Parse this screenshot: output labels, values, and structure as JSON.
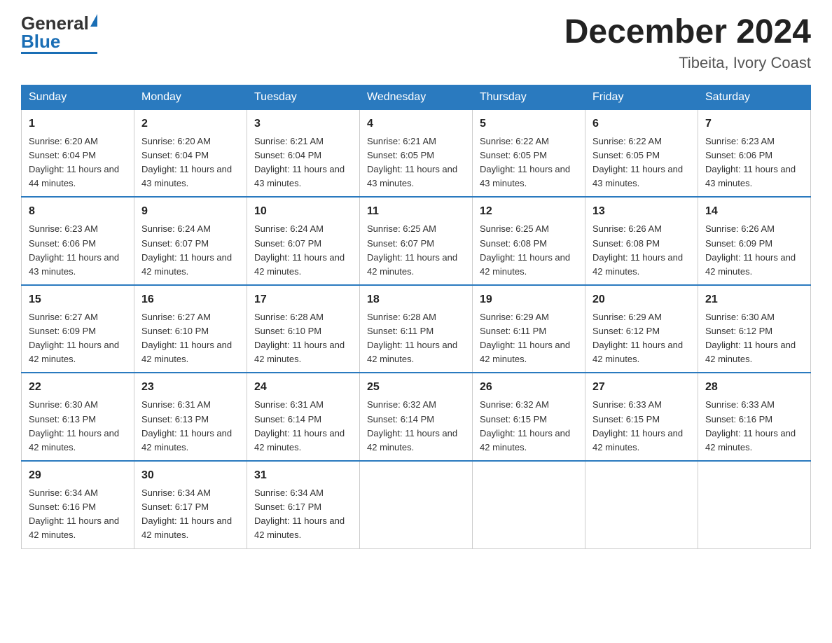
{
  "logo": {
    "general": "General",
    "blue": "Blue"
  },
  "title": "December 2024",
  "location": "Tibeita, Ivory Coast",
  "days_of_week": [
    "Sunday",
    "Monday",
    "Tuesday",
    "Wednesday",
    "Thursday",
    "Friday",
    "Saturday"
  ],
  "weeks": [
    [
      {
        "day": "1",
        "sunrise": "6:20 AM",
        "sunset": "6:04 PM",
        "daylight": "11 hours and 44 minutes."
      },
      {
        "day": "2",
        "sunrise": "6:20 AM",
        "sunset": "6:04 PM",
        "daylight": "11 hours and 43 minutes."
      },
      {
        "day": "3",
        "sunrise": "6:21 AM",
        "sunset": "6:04 PM",
        "daylight": "11 hours and 43 minutes."
      },
      {
        "day": "4",
        "sunrise": "6:21 AM",
        "sunset": "6:05 PM",
        "daylight": "11 hours and 43 minutes."
      },
      {
        "day": "5",
        "sunrise": "6:22 AM",
        "sunset": "6:05 PM",
        "daylight": "11 hours and 43 minutes."
      },
      {
        "day": "6",
        "sunrise": "6:22 AM",
        "sunset": "6:05 PM",
        "daylight": "11 hours and 43 minutes."
      },
      {
        "day": "7",
        "sunrise": "6:23 AM",
        "sunset": "6:06 PM",
        "daylight": "11 hours and 43 minutes."
      }
    ],
    [
      {
        "day": "8",
        "sunrise": "6:23 AM",
        "sunset": "6:06 PM",
        "daylight": "11 hours and 43 minutes."
      },
      {
        "day": "9",
        "sunrise": "6:24 AM",
        "sunset": "6:07 PM",
        "daylight": "11 hours and 42 minutes."
      },
      {
        "day": "10",
        "sunrise": "6:24 AM",
        "sunset": "6:07 PM",
        "daylight": "11 hours and 42 minutes."
      },
      {
        "day": "11",
        "sunrise": "6:25 AM",
        "sunset": "6:07 PM",
        "daylight": "11 hours and 42 minutes."
      },
      {
        "day": "12",
        "sunrise": "6:25 AM",
        "sunset": "6:08 PM",
        "daylight": "11 hours and 42 minutes."
      },
      {
        "day": "13",
        "sunrise": "6:26 AM",
        "sunset": "6:08 PM",
        "daylight": "11 hours and 42 minutes."
      },
      {
        "day": "14",
        "sunrise": "6:26 AM",
        "sunset": "6:09 PM",
        "daylight": "11 hours and 42 minutes."
      }
    ],
    [
      {
        "day": "15",
        "sunrise": "6:27 AM",
        "sunset": "6:09 PM",
        "daylight": "11 hours and 42 minutes."
      },
      {
        "day": "16",
        "sunrise": "6:27 AM",
        "sunset": "6:10 PM",
        "daylight": "11 hours and 42 minutes."
      },
      {
        "day": "17",
        "sunrise": "6:28 AM",
        "sunset": "6:10 PM",
        "daylight": "11 hours and 42 minutes."
      },
      {
        "day": "18",
        "sunrise": "6:28 AM",
        "sunset": "6:11 PM",
        "daylight": "11 hours and 42 minutes."
      },
      {
        "day": "19",
        "sunrise": "6:29 AM",
        "sunset": "6:11 PM",
        "daylight": "11 hours and 42 minutes."
      },
      {
        "day": "20",
        "sunrise": "6:29 AM",
        "sunset": "6:12 PM",
        "daylight": "11 hours and 42 minutes."
      },
      {
        "day": "21",
        "sunrise": "6:30 AM",
        "sunset": "6:12 PM",
        "daylight": "11 hours and 42 minutes."
      }
    ],
    [
      {
        "day": "22",
        "sunrise": "6:30 AM",
        "sunset": "6:13 PM",
        "daylight": "11 hours and 42 minutes."
      },
      {
        "day": "23",
        "sunrise": "6:31 AM",
        "sunset": "6:13 PM",
        "daylight": "11 hours and 42 minutes."
      },
      {
        "day": "24",
        "sunrise": "6:31 AM",
        "sunset": "6:14 PM",
        "daylight": "11 hours and 42 minutes."
      },
      {
        "day": "25",
        "sunrise": "6:32 AM",
        "sunset": "6:14 PM",
        "daylight": "11 hours and 42 minutes."
      },
      {
        "day": "26",
        "sunrise": "6:32 AM",
        "sunset": "6:15 PM",
        "daylight": "11 hours and 42 minutes."
      },
      {
        "day": "27",
        "sunrise": "6:33 AM",
        "sunset": "6:15 PM",
        "daylight": "11 hours and 42 minutes."
      },
      {
        "day": "28",
        "sunrise": "6:33 AM",
        "sunset": "6:16 PM",
        "daylight": "11 hours and 42 minutes."
      }
    ],
    [
      {
        "day": "29",
        "sunrise": "6:34 AM",
        "sunset": "6:16 PM",
        "daylight": "11 hours and 42 minutes."
      },
      {
        "day": "30",
        "sunrise": "6:34 AM",
        "sunset": "6:17 PM",
        "daylight": "11 hours and 42 minutes."
      },
      {
        "day": "31",
        "sunrise": "6:34 AM",
        "sunset": "6:17 PM",
        "daylight": "11 hours and 42 minutes."
      },
      null,
      null,
      null,
      null
    ]
  ]
}
